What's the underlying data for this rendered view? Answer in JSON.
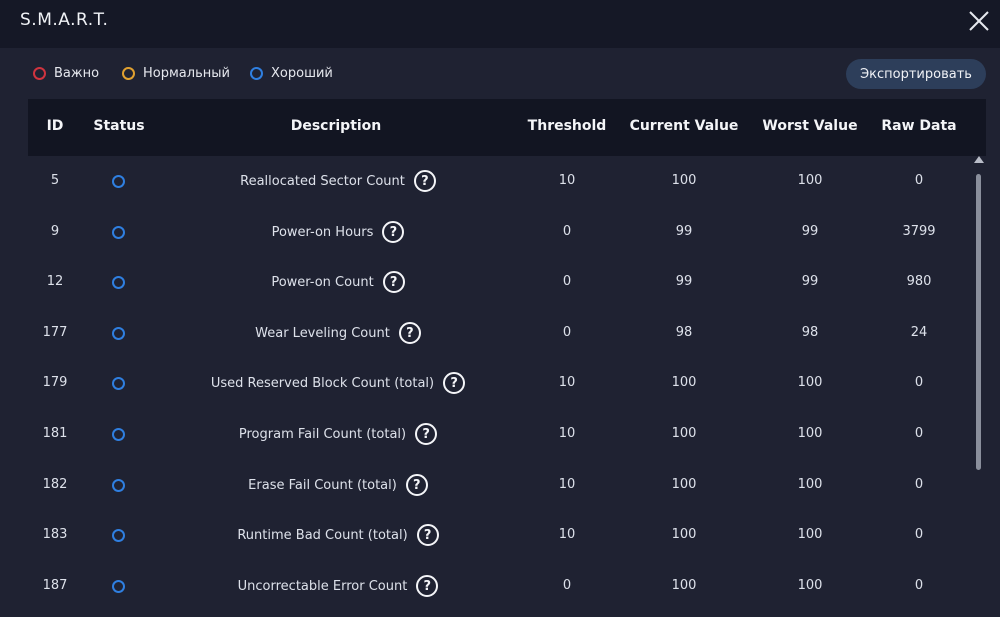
{
  "window": {
    "title": "S.M.A.R.T."
  },
  "legend": [
    {
      "label": "Важно",
      "color": "#d0343f"
    },
    {
      "label": "Нормальный",
      "color": "#e0a030"
    },
    {
      "label": "Хороший",
      "color": "#2f7fe0"
    }
  ],
  "toolbar": {
    "export_label": "Экспортировать"
  },
  "table": {
    "headers": {
      "id": "ID",
      "status": "Status",
      "description": "Description",
      "threshold": "Threshold",
      "current": "Current Value",
      "worst": "Worst Value",
      "raw": "Raw Data"
    },
    "rows": [
      {
        "id": "5",
        "status": "good",
        "description": "Reallocated Sector Count",
        "threshold": "10",
        "current": "100",
        "worst": "100",
        "raw": "0"
      },
      {
        "id": "9",
        "status": "good",
        "description": "Power-on Hours",
        "threshold": "0",
        "current": "99",
        "worst": "99",
        "raw": "3799"
      },
      {
        "id": "12",
        "status": "good",
        "description": "Power-on Count",
        "threshold": "0",
        "current": "99",
        "worst": "99",
        "raw": "980"
      },
      {
        "id": "177",
        "status": "good",
        "description": "Wear Leveling Count",
        "threshold": "0",
        "current": "98",
        "worst": "98",
        "raw": "24"
      },
      {
        "id": "179",
        "status": "good",
        "description": "Used Reserved Block Count (total)",
        "threshold": "10",
        "current": "100",
        "worst": "100",
        "raw": "0"
      },
      {
        "id": "181",
        "status": "good",
        "description": "Program Fail Count (total)",
        "threshold": "10",
        "current": "100",
        "worst": "100",
        "raw": "0"
      },
      {
        "id": "182",
        "status": "good",
        "description": "Erase Fail Count (total)",
        "threshold": "10",
        "current": "100",
        "worst": "100",
        "raw": "0"
      },
      {
        "id": "183",
        "status": "good",
        "description": "Runtime Bad Count (total)",
        "threshold": "10",
        "current": "100",
        "worst": "100",
        "raw": "0"
      },
      {
        "id": "187",
        "status": "good",
        "description": "Uncorrectable Error Count",
        "threshold": "0",
        "current": "100",
        "worst": "100",
        "raw": "0"
      }
    ]
  },
  "icons": {
    "close": "close-icon",
    "help": "question-circle-icon",
    "status": "status-ring-icon"
  },
  "help_glyph": "?",
  "colors": {
    "background": "#1f2232",
    "titlebar": "#151826",
    "table_header": "#121522",
    "export_button": "#2d3e5a",
    "status_good": "#2f7fe0"
  }
}
